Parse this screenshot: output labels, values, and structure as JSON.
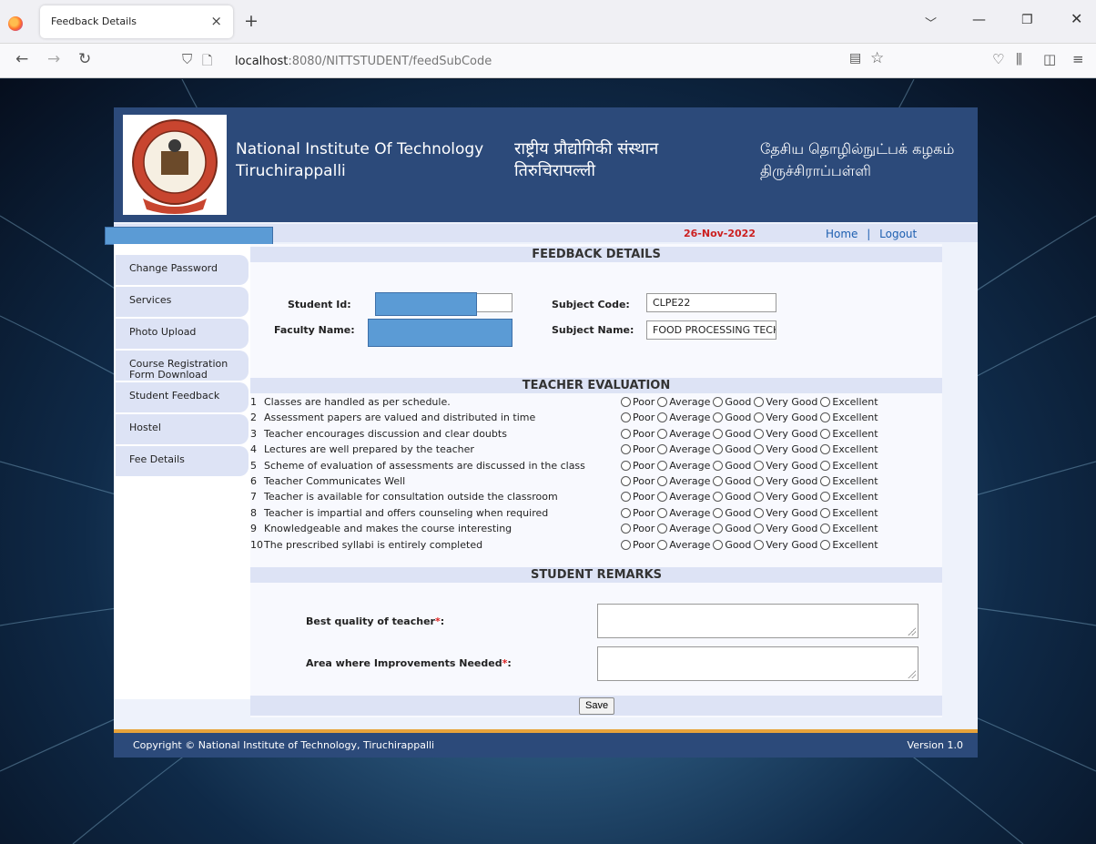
{
  "browser": {
    "tab_title": "Feedback Details",
    "url_host": "localhost",
    "url_rest": ":8080/NITTSTUDENT/feedSubCode"
  },
  "header": {
    "en_line1": "National Institute Of Technology",
    "en_line2": "Tiruchirappalli",
    "hi_line1": "राष्ट्रीय प्रौद्योगिकी संस्थान",
    "hi_line2": "तिरुचिरापल्ली",
    "ta_line1": "தேசிய தொழில்நுட்பக் கழகம்",
    "ta_line2": "திருச்சிராப்பள்ளி"
  },
  "infobar": {
    "date": "26-Nov-2022",
    "home": "Home",
    "separator": "|",
    "logout": "Logout"
  },
  "sidebar": {
    "items": [
      "Change Password",
      "Services",
      "Photo Upload",
      "Course Registration Form Download",
      "Student Feedback",
      "Hostel",
      "Fee Details"
    ]
  },
  "feedback": {
    "title": "FEEDBACK DETAILS",
    "student_id_label": "Student Id:",
    "faculty_name_label": "Faculty Name:",
    "subject_code_label": "Subject Code:",
    "subject_code_value": "CLPE22",
    "subject_name_label": "Subject Name:",
    "subject_name_value": "FOOD PROCESSING TECH"
  },
  "evaluation": {
    "title": "TEACHER EVALUATION",
    "options": [
      "Poor",
      "Average",
      "Good",
      "Very Good",
      "Excellent"
    ],
    "questions": [
      {
        "num": "1",
        "text": "Classes are handled as per schedule."
      },
      {
        "num": "2",
        "text": "Assessment papers are valued and distributed in time"
      },
      {
        "num": "3",
        "text": "Teacher encourages discussion and clear doubts"
      },
      {
        "num": "4",
        "text": "Lectures are well prepared by the teacher"
      },
      {
        "num": "5",
        "text": "Scheme of evaluation of assessments are discussed in the class"
      },
      {
        "num": "6",
        "text": "Teacher Communicates Well"
      },
      {
        "num": "7",
        "text": "Teacher is available for consultation outside the classroom"
      },
      {
        "num": "8",
        "text": "Teacher is impartial and offers counseling when required"
      },
      {
        "num": "9",
        "text": "Knowledgeable and makes the course interesting"
      },
      {
        "num": "10",
        "text": "The prescribed syllabi is entirely completed"
      }
    ]
  },
  "remarks": {
    "title": "STUDENT REMARKS",
    "best_quality_label": "Best quality of teacher",
    "improvement_label": "Area where Improvements Needed",
    "required_mark": "*",
    "colon": ":"
  },
  "save_label": "Save",
  "footer": {
    "copyright": "Copyright © National Institute of Technology, Tiruchirappalli",
    "version": "Version 1.0"
  },
  "colors": {
    "header_bg": "#2c4a7a",
    "accent_bar": "#dde3f5",
    "date_red": "#cc1f1f",
    "footer_stripe": "#e8a33a",
    "redaction": "#5b9bd5"
  }
}
